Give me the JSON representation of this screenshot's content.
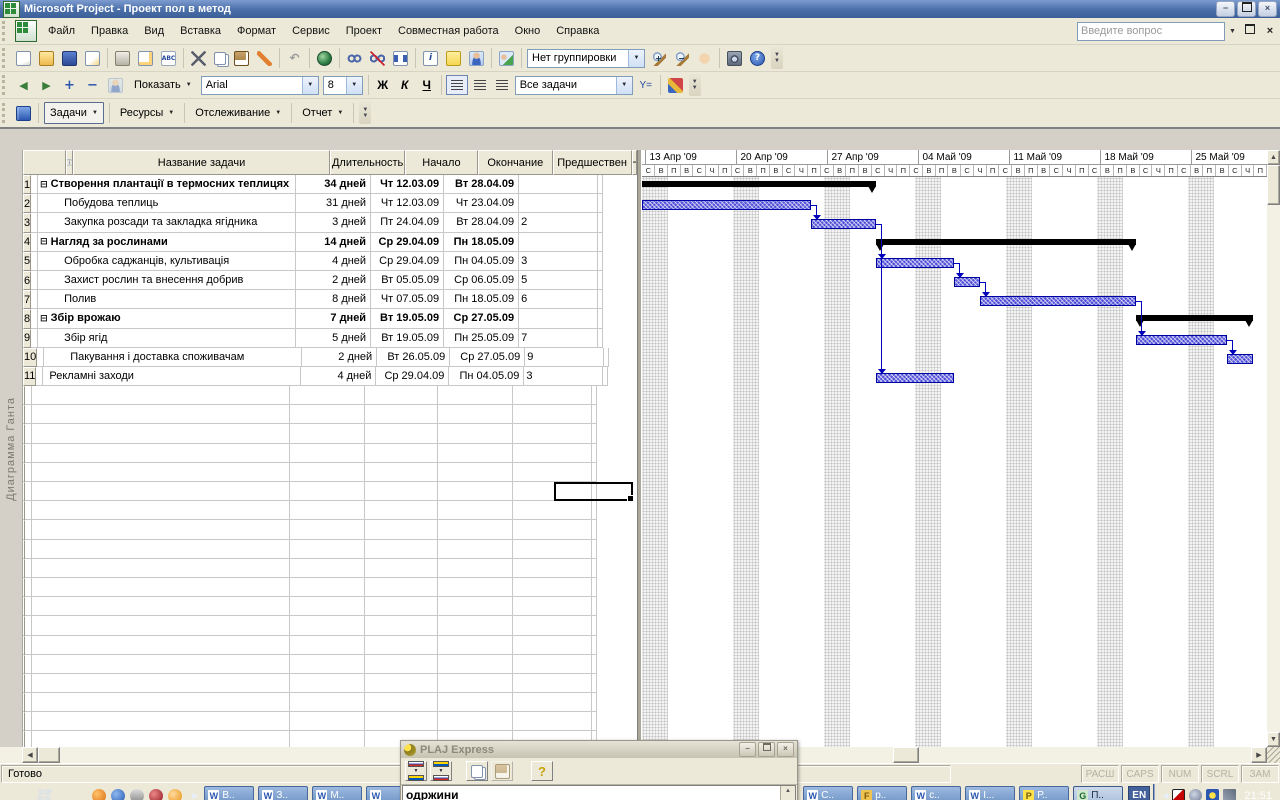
{
  "window": {
    "title": "Microsoft Project - Проект пол в метод",
    "controls": {
      "minimize": "−",
      "restore": "❐",
      "close": "×"
    },
    "question_placeholder": "Введите вопрос"
  },
  "menus": [
    "Файл",
    "Правка",
    "Вид",
    "Вставка",
    "Формат",
    "Сервис",
    "Проект",
    "Совместная работа",
    "Окно",
    "Справка"
  ],
  "toolbar_standard": {
    "icons": [
      {
        "name": "new-document",
        "cls": "ic-page"
      },
      {
        "name": "open",
        "cls": "ic-folder"
      },
      {
        "name": "save",
        "cls": "ic-disk"
      },
      {
        "name": "search",
        "cls": "ic-search",
        "sep_after": true
      },
      {
        "name": "print",
        "cls": "ic-print"
      },
      {
        "name": "print-preview",
        "cls": "ic-preview"
      },
      {
        "name": "spelling",
        "cls": "ic-spell",
        "ch": "ABC",
        "sep_after": true
      },
      {
        "name": "cut",
        "cls": "ic-cut"
      },
      {
        "name": "copy",
        "cls": "ic-copy"
      },
      {
        "name": "paste",
        "cls": "ic-paste"
      },
      {
        "name": "format-painter",
        "cls": "ic-brush",
        "sep_after": true
      },
      {
        "name": "undo",
        "cls": "ic-undo",
        "ch": "↶",
        "sep_after": true
      },
      {
        "name": "insert-hyperlink",
        "cls": "ic-globe",
        "sep_after": true
      },
      {
        "name": "link-tasks",
        "cls": "ic-chain"
      },
      {
        "name": "unlink-tasks",
        "cls": "ic-chain-broken"
      },
      {
        "name": "split-task",
        "cls": "ic-split",
        "sep_after": true
      },
      {
        "name": "task-information",
        "cls": "ic-info",
        "ch": "i"
      },
      {
        "name": "task-notes",
        "cls": "ic-note"
      },
      {
        "name": "assign-resources",
        "cls": "ic-person",
        "sep_after": true
      },
      {
        "name": "publish-all-information",
        "cls": "ic-publish",
        "sep_after": true
      }
    ],
    "group_combo": "Нет группировки",
    "icons_right": [
      {
        "name": "zoom-in",
        "cls": "ic-mag",
        "ch": "+"
      },
      {
        "name": "zoom-out",
        "cls": "ic-mag",
        "ch": "−"
      },
      {
        "name": "go-to-selected-task",
        "cls": "ic-hand",
        "sep_after": true
      },
      {
        "name": "copy-picture",
        "cls": "ic-cam"
      },
      {
        "name": "help",
        "cls": "ic-help",
        "ch": "?"
      }
    ]
  },
  "toolbar_formatting": {
    "icons_left": [
      {
        "name": "outdent",
        "cls": "ic-arrow",
        "ch": "◀"
      },
      {
        "name": "indent",
        "cls": "ic-arrow",
        "ch": "▶"
      },
      {
        "name": "show-subtasks",
        "cls": "ic-plus",
        "ch": "+"
      },
      {
        "name": "hide-subtasks",
        "cls": "ic-minus",
        "ch": "−"
      },
      {
        "name": "hide-assignments",
        "cls": "ic-person ic-person-gray"
      }
    ],
    "show_button": "Показать",
    "font_combo": "Arial",
    "font_size_combo": "8",
    "bold": "Ж",
    "italic": "К",
    "underline": "Ч",
    "filter_combo": "Все задачи",
    "autofilter_label": "Y="
  },
  "toolbar_guide": {
    "buttons": [
      "Задачи",
      "Ресурсы",
      "Отслеживание",
      "Отчет"
    ],
    "active": "Задачи"
  },
  "view_label": "Диаграмма Ганта",
  "table": {
    "headers": {
      "name": "Название задачи",
      "duration": "Длительность",
      "start": "Начало",
      "finish": "Окончание",
      "pred": "Предшествен",
      "sliver": "Н"
    },
    "rows": [
      {
        "id": 1,
        "summary": true,
        "level": 0,
        "name": "Створення плантації  в термосних теплицях",
        "duration": "34 дней",
        "start": "Чт 12.03.09",
        "finish": "Вт 28.04.09",
        "pred": ""
      },
      {
        "id": 2,
        "summary": false,
        "level": 1,
        "name": "Побудова теплиць",
        "duration": "31 дней",
        "start": "Чт 12.03.09",
        "finish": "Чт 23.04.09",
        "pred": ""
      },
      {
        "id": 3,
        "summary": false,
        "level": 1,
        "name": "Закупка розсади та закладка ягідника",
        "duration": "3 дней",
        "start": "Пт 24.04.09",
        "finish": "Вт 28.04.09",
        "pred": "2"
      },
      {
        "id": 4,
        "summary": true,
        "level": 0,
        "name": "Нагляд за рослинами",
        "duration": "14 дней",
        "start": "Ср 29.04.09",
        "finish": "Пн 18.05.09",
        "pred": ""
      },
      {
        "id": 5,
        "summary": false,
        "level": 1,
        "name": "Обробка саджанців, культивація",
        "duration": "4 дней",
        "start": "Ср 29.04.09",
        "finish": "Пн 04.05.09",
        "pred": "3"
      },
      {
        "id": 6,
        "summary": false,
        "level": 1,
        "name": "Захист рослин та внесення добрив",
        "duration": "2 дней",
        "start": "Вт 05.05.09",
        "finish": "Ср 06.05.09",
        "pred": "5"
      },
      {
        "id": 7,
        "summary": false,
        "level": 1,
        "name": "Полив",
        "duration": "8 дней",
        "start": "Чт 07.05.09",
        "finish": "Пн 18.05.09",
        "pred": "6"
      },
      {
        "id": 8,
        "summary": true,
        "level": 0,
        "name": "Збір врожаю",
        "duration": "7 дней",
        "start": "Вт 19.05.09",
        "finish": "Ср 27.05.09",
        "pred": ""
      },
      {
        "id": 9,
        "summary": false,
        "level": 1,
        "name": "Збір ягід",
        "duration": "5 дней",
        "start": "Вт 19.05.09",
        "finish": "Пн 25.05.09",
        "pred": "7"
      },
      {
        "id": 10,
        "summary": false,
        "level": 1,
        "name": "Пакування  і доставка споживачам",
        "duration": "2 дней",
        "start": "Вт 26.05.09",
        "finish": "Ср 27.05.09",
        "pred": "9"
      },
      {
        "id": 11,
        "summary": false,
        "level": 0,
        "name": "Рекламні заходи",
        "duration": "4 дней",
        "start": "Ср 29.04.09",
        "finish": "Пн 04.05.09",
        "pred": "3"
      }
    ],
    "selection": {
      "row": 17,
      "column": "pred"
    }
  },
  "timeline": {
    "weeks": [
      "13 Апр '09",
      "20 Апр '09",
      "27 Апр '09",
      "04 Май '09",
      "11 Май '09",
      "18 Май '09",
      "25 Май '09"
    ],
    "leading_days": [
      "С",
      "В"
    ],
    "week_day_letters": [
      "П",
      "В",
      "С",
      "Ч",
      "П",
      "С",
      "В"
    ]
  },
  "gantt": {
    "day_width": 13,
    "row_height": 19.2,
    "weekend_start_indices": [
      0,
      7,
      14,
      21,
      28,
      35,
      42
    ],
    "bars": [
      {
        "row": 1,
        "type": "summary",
        "start": -20,
        "end": 18,
        "clip_start": true
      },
      {
        "row": 2,
        "type": "task",
        "start": -20,
        "end": 13,
        "clip_start": true
      },
      {
        "row": 3,
        "type": "task",
        "start": 13,
        "end": 18
      },
      {
        "row": 4,
        "type": "summary",
        "start": 18,
        "end": 38
      },
      {
        "row": 5,
        "type": "task",
        "start": 18,
        "end": 24
      },
      {
        "row": 6,
        "type": "task",
        "start": 24,
        "end": 26
      },
      {
        "row": 7,
        "type": "task",
        "start": 26,
        "end": 38
      },
      {
        "row": 8,
        "type": "summary",
        "start": 38,
        "end": 47
      },
      {
        "row": 9,
        "type": "task",
        "start": 38,
        "end": 45
      },
      {
        "row": 10,
        "type": "task",
        "start": 45,
        "end": 47
      },
      {
        "row": 11,
        "type": "task",
        "start": 18,
        "end": 24
      }
    ],
    "links": [
      {
        "from": 2,
        "to": 3
      },
      {
        "from": 3,
        "to": 5
      },
      {
        "from": 3,
        "to": 11
      },
      {
        "from": 5,
        "to": 6
      },
      {
        "from": 6,
        "to": 7
      },
      {
        "from": 7,
        "to": 9
      },
      {
        "from": 9,
        "to": 10
      }
    ],
    "colors": {
      "task_bar": "#4d4dd8",
      "task_border": "#0000a0",
      "summary": "#000000",
      "link": "#0000bb"
    }
  },
  "statusbar": {
    "ready": "Готово",
    "indicators": [
      "РАСШ",
      "CAPS",
      "NUM",
      "SCRL",
      "ЗАМ"
    ]
  },
  "taskbar": {
    "quick_launch": [
      {
        "name": "media-player",
        "color": "radial-gradient(circle at 35% 35%,#ffc36a,#d96a12)"
      },
      {
        "name": "mail-client",
        "color": "radial-gradient(circle at 35% 35%,#8fb8f0,#2456ad)"
      },
      {
        "name": "media-player-classic",
        "color": "linear-gradient(#ddd,#888)"
      },
      {
        "name": "browser",
        "color": "radial-gradient(circle at 35% 35%,#e88,#8c1420)"
      },
      {
        "name": "messenger",
        "color": "radial-gradient(circle at 35% 35%,#ffd9a0,#e8920f)"
      }
    ],
    "buttons_left": [
      {
        "label": "В..",
        "icon": "W"
      },
      {
        "label": "З..",
        "icon": "W"
      },
      {
        "label": "М..",
        "icon": "W"
      },
      {
        "label": "",
        "icon": "W"
      }
    ],
    "buttons_right": [
      {
        "label": "С..",
        "icon": "W"
      },
      {
        "label": "р..",
        "icon": "F"
      },
      {
        "label": "с..",
        "icon": "W"
      },
      {
        "label": "І...",
        "icon": "W"
      },
      {
        "label": "Р..",
        "icon": "P"
      },
      {
        "label": "П..",
        "icon": "G",
        "active": true
      }
    ],
    "language": "EN",
    "time": "21:51"
  },
  "plaj": {
    "title": "PLAJ Express",
    "controls": {
      "minimize": "−",
      "restore": "❐",
      "close": "×"
    },
    "content_text": "одржини",
    "help_label": "?"
  }
}
